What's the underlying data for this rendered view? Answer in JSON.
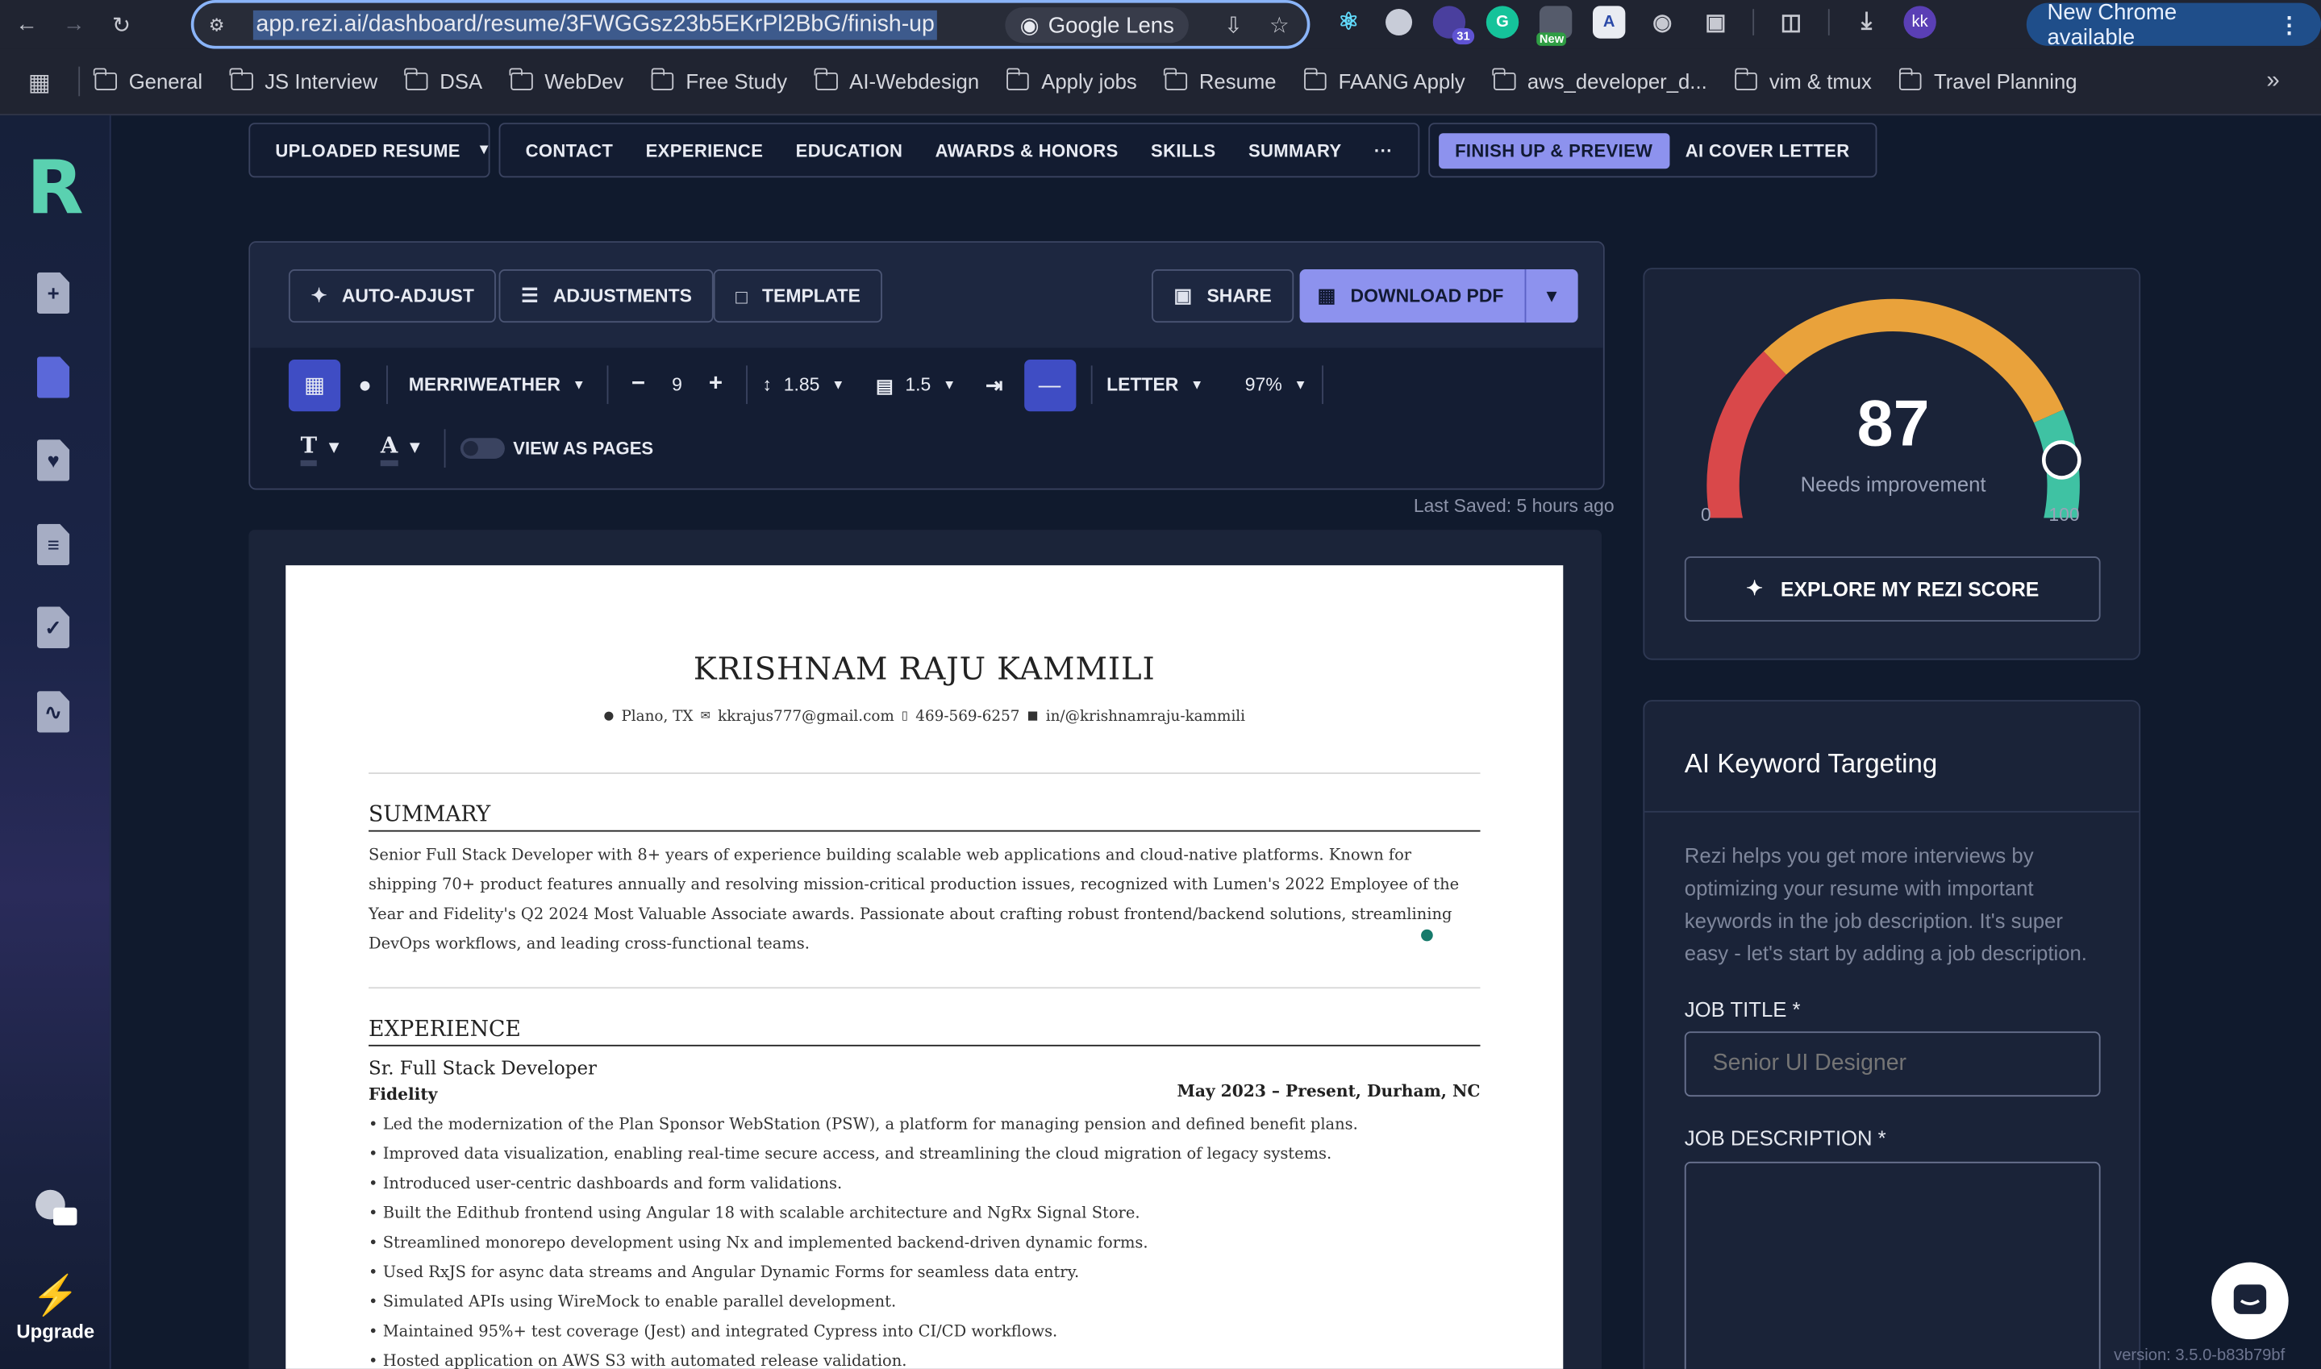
{
  "browser": {
    "url": "app.rezi.ai/dashboard/resume/3FWGGsz23b5EKrPl2BbG/finish-up",
    "lens_label": "Google Lens",
    "profile_initials": "kk",
    "ext_badge_count": "31",
    "ext_new_label": "New",
    "update_label": "New Chrome available",
    "bookmarks": [
      "General",
      "JS Interview",
      "DSA",
      "WebDev",
      "Free Study",
      "AI-Webdesign",
      "Apply jobs",
      "Resume",
      "FAANG Apply",
      "aws_developer_d...",
      "vim & tmux",
      "Travel Planning"
    ]
  },
  "rail": {
    "logo": "R",
    "upgrade_label": "Upgrade"
  },
  "tabs": {
    "uploaded": "UPLOADED RESUME",
    "items": [
      "CONTACT",
      "EXPERIENCE",
      "EDUCATION",
      "AWARDS & HONORS",
      "SKILLS",
      "SUMMARY"
    ],
    "more": "···",
    "finish": "FINISH UP & PREVIEW",
    "cover": "AI COVER LETTER"
  },
  "toolbar": {
    "auto_adjust": "AUTO-ADJUST",
    "adjustments": "ADJUSTMENTS",
    "template": "TEMPLATE",
    "share": "SHARE",
    "download": "DOWNLOAD PDF",
    "font": "MERRIWEATHER",
    "font_size": "9",
    "line_height": "1.85",
    "margin": "1.5",
    "paper": "LETTER",
    "zoom": "97%",
    "view_as_pages": "VIEW AS PAGES",
    "last_saved": "Last Saved: 5 hours ago"
  },
  "resume": {
    "name": "KRISHNAM RAJU KAMMILI",
    "location": "Plano,  TX",
    "email": "kkrajus777@gmail.com",
    "phone": "469-569-6257",
    "linkedin": "in/@krishnamraju-kammili",
    "summary_heading": "SUMMARY",
    "summary": "Senior Full Stack Developer with 8+ years of experience building scalable web applications and cloud-native platforms. Known for shipping 70+ product features annually and resolving mission-critical production issues, recognized with Lumen's 2022 Employee of the Year and Fidelity's Q2 2024 Most Valuable Associate awards. Passionate about crafting robust frontend/backend solutions, streamlining DevOps workflows, and leading cross-functional teams.",
    "experience_heading": "EXPERIENCE",
    "role": "Sr. Full Stack Developer",
    "company": "Fidelity",
    "dates_location": "May 2023 – Present,  Durham, NC",
    "bullets": [
      "Led the modernization of the Plan Sponsor WebStation (PSW), a platform for managing pension and defined benefit plans.",
      "Improved data visualization, enabling real-time secure access, and streamlining the cloud migration of legacy systems.",
      "Introduced user-centric dashboards and form validations.",
      "Built the Edithub frontend using Angular 18 with scalable architecture and NgRx Signal Store.",
      "Streamlined monorepo development using Nx and implemented backend-driven dynamic forms.",
      "Used RxJS for async data streams and Angular Dynamic Forms for seamless data entry.",
      "Simulated APIs using WireMock to enable parallel development.",
      "Maintained 95%+ test coverage (Jest) and integrated Cypress into CI/CD workflows.",
      "Hosted application on AWS S3 with automated release validation."
    ]
  },
  "score": {
    "value": "87",
    "value_fraction": 0.87,
    "label": "Needs improvement",
    "min": "0",
    "max": "100",
    "explore": "EXPLORE MY REZI SCORE",
    "colors": {
      "low": "#d9484a",
      "mid": "#e9a23b",
      "high": "#3fc2a3"
    }
  },
  "keywords": {
    "title": "AI Keyword Targeting",
    "description": "Rezi helps you get more interviews by optimizing your resume with important keywords in the job description. It's super easy - let's start by adding a job description.",
    "job_title_label": "JOB TITLE *",
    "job_title_placeholder": "Senior UI Designer",
    "job_desc_label": "JOB DESCRIPTION *"
  },
  "version": "version: 3.5.0-b83b79bf"
}
